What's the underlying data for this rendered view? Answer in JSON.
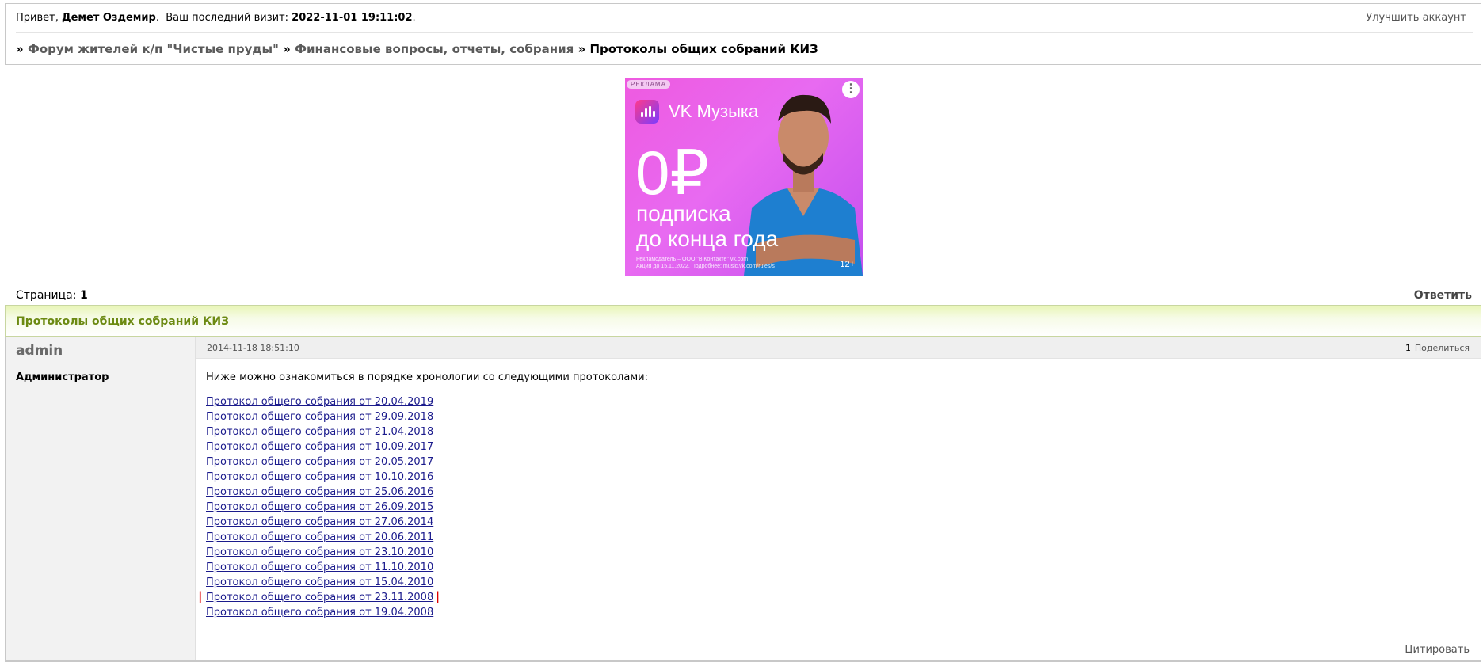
{
  "header": {
    "greeting": "Привет,",
    "user_name": "Демет Оздемир",
    "last_visit_label": "Ваш последний визит:",
    "last_visit_value": "2022-11-01 19:11:02",
    "upgrade_link": "Улучшить аккаунт"
  },
  "breadcrumb": {
    "sep": "»",
    "items": [
      "Форум жителей к/п \"Чистые пруды\"",
      "Финансовые вопросы, отчеты, собрания"
    ],
    "current": "Протоколы общих собраний КИЗ"
  },
  "ad": {
    "label": "РЕКЛАМА",
    "brand": "VK Музыка",
    "price": "0₽",
    "line1": "подписка",
    "line2": "до конца года",
    "fine1": "Рекламодатель – ООО \"В Контакте\" vk.com",
    "fine2": "Акция до 15.11.2022. Подробнее: music.vk.com/rules/s",
    "age": "12+",
    "menu_icon": "⋮",
    "colors": {
      "bg_start": "#ee5ae0",
      "bg_end": "#c44fef",
      "shirt": "#1e7fd0"
    }
  },
  "pagination": {
    "label": "Страница:",
    "current": "1"
  },
  "reply_button": "Ответить",
  "topic": {
    "title": "Протоколы общих собраний КИЗ"
  },
  "post": {
    "author": "admin",
    "role": "Администратор",
    "date": "2014-11-18 18:51:10",
    "number": "1",
    "share_label": "Поделиться",
    "intro": "Ниже можно ознакомиться в порядке хронологии со следующими протоколами:",
    "links": [
      "Протокол общего собрания от 20.04.2019",
      "Протокол общего собрания от 29.09.2018",
      "Протокол общего собрания от 21.04.2018",
      "Протокол общего собрания от 10.09.2017",
      "Протокол общего собрания от 20.05.2017",
      "Протокол общего собрания от 10.10.2016",
      "Протокол общего собрания от 25.06.2016",
      "Протокол общего собрания от 26.09.2015",
      "Протокол общего собрания от 27.06.2014",
      "Протокол общего собрания от 20.06.2011",
      "Протокол общего собрания от 23.10.2010",
      "Протокол общего собрания от 11.10.2010",
      "Протокол общего собрания от 15.04.2010",
      "Протокол общего собрания от 23.11.2008",
      "Протокол общего собрания от 19.04.2008"
    ],
    "highlighted_index": 13,
    "quote_label": "Цитировать"
  },
  "colors": {
    "topic_title": "#6c8a12",
    "link": "#1a1a8c",
    "highlight_mark": "#e00000"
  }
}
